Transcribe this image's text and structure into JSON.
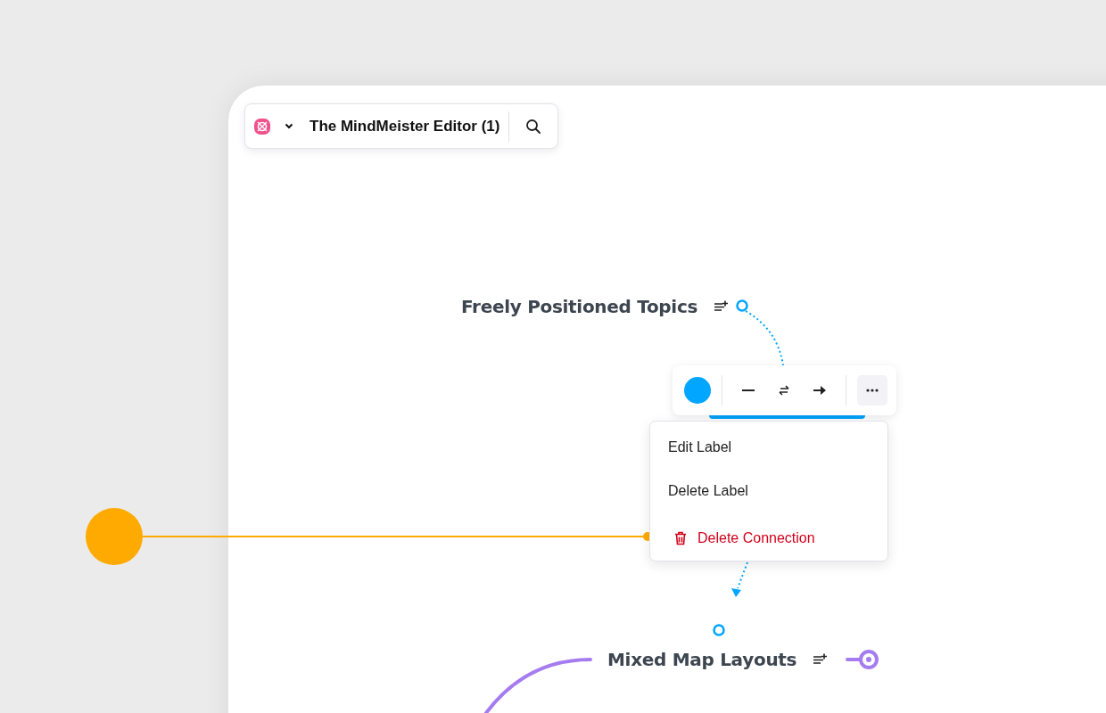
{
  "header": {
    "title": "The MindMeister Editor (1)"
  },
  "topics": [
    {
      "text": "Freely Positioned Topics"
    },
    {
      "text": "Mixed Map Layouts"
    }
  ],
  "connection_toolbar": {
    "color": "#00a6ff",
    "buttons": [
      {
        "kind": "line",
        "selected": false
      },
      {
        "kind": "swap",
        "selected": false
      },
      {
        "kind": "arrow",
        "selected": false
      },
      {
        "kind": "more",
        "selected": true
      }
    ]
  },
  "context_menu": [
    {
      "label": "Edit Label",
      "kind": "normal"
    },
    {
      "label": "Delete Label",
      "kind": "normal"
    },
    {
      "label": "Delete Connection",
      "kind": "danger"
    }
  ]
}
